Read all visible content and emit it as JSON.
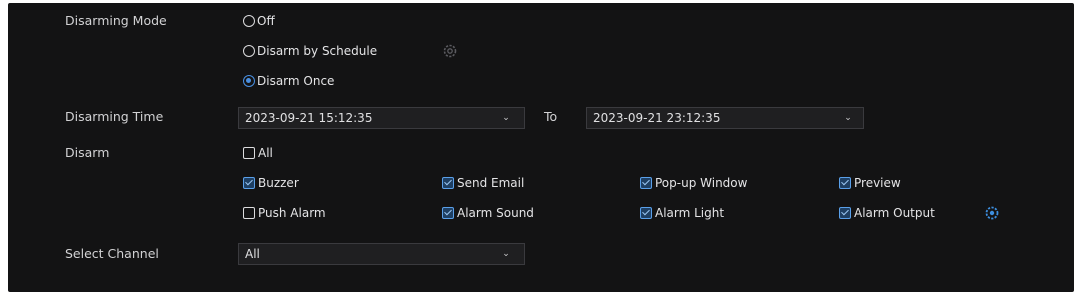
{
  "disarming_mode": {
    "label": "Disarming Mode",
    "options": [
      {
        "label": "Off",
        "selected": false
      },
      {
        "label": "Disarm by Schedule",
        "selected": false
      },
      {
        "label": "Disarm Once",
        "selected": true
      }
    ],
    "schedule_icon": "gear-icon"
  },
  "disarming_time": {
    "label": "Disarming Time",
    "start": "2023-09-21 15:12:35",
    "to_label": "To",
    "end": "2023-09-21 23:12:35"
  },
  "disarm": {
    "label": "Disarm",
    "all": {
      "label": "All",
      "checked": false
    },
    "items": [
      {
        "label": "Buzzer",
        "checked": true
      },
      {
        "label": "Send Email",
        "checked": true
      },
      {
        "label": "Pop-up Window",
        "checked": true
      },
      {
        "label": "Preview",
        "checked": true
      },
      {
        "label": "Push Alarm",
        "checked": false
      },
      {
        "label": "Alarm Sound",
        "checked": true
      },
      {
        "label": "Alarm Light",
        "checked": true
      },
      {
        "label": "Alarm Output",
        "checked": true
      }
    ],
    "settings_icon": "gear-icon"
  },
  "select_channel": {
    "label": "Select Channel",
    "value": "All"
  },
  "colors": {
    "panel_bg": "#131314",
    "accent": "#4a90e2",
    "gear_blue": "#3d8fe0"
  }
}
